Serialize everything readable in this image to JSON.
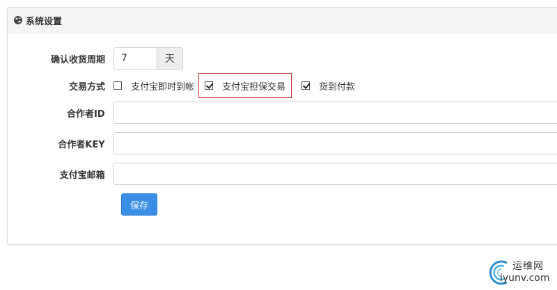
{
  "panel": {
    "title": "系统设置"
  },
  "form": {
    "receipt_period": {
      "label": "确认收货周期",
      "value": "7",
      "unit": "天"
    },
    "trade_method": {
      "label": "交易方式",
      "options": [
        {
          "label": "支付宝即时到帐",
          "checked": false
        },
        {
          "label": "支付宝担保交易",
          "checked": true
        },
        {
          "label": "货到付款",
          "checked": true
        }
      ]
    },
    "partner_id": {
      "label": "合作者ID",
      "value": ""
    },
    "partner_key": {
      "label": "合作者KEY",
      "value": ""
    },
    "alipay_email": {
      "label": "支付宝邮箱",
      "value": ""
    },
    "save_label": "保存"
  },
  "watermark": {
    "line1": "运维网",
    "line2": "iyunv.com"
  },
  "colors": {
    "primary_button": "#3a8ee6",
    "highlight_border": "#c0292b"
  }
}
